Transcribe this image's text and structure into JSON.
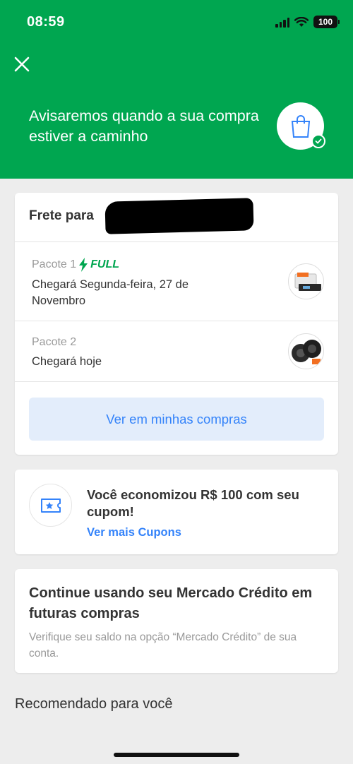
{
  "status_bar": {
    "time": "08:59",
    "battery": "100"
  },
  "header": {
    "message": "Avisaremos quando a sua compra estiver a caminho",
    "bg_color": "#00a650"
  },
  "shipping": {
    "title": "Frete para ",
    "packages": [
      {
        "label": "Pacote 1",
        "badge": "FULL",
        "delivery": "Chegará Segunda-feira, 27 de Novembro"
      },
      {
        "label": "Pacote 2",
        "delivery": "Chegará hoje"
      }
    ],
    "button_label": "Ver em minhas compras"
  },
  "coupon": {
    "message": "Você economizou R$ 100 com seu cupom!",
    "link_label": "Ver mais Cupons"
  },
  "credit": {
    "title": "Continue usando seu Mercado Crédito em futuras compras",
    "text": "Verifique seu saldo na opção “Mercado Crédito” de sua conta."
  },
  "recommendations": {
    "title": "Recomendado para você"
  },
  "colors": {
    "accent_blue": "#3483fa",
    "brand_green": "#00a650"
  },
  "icons": [
    "close-icon",
    "shopping-bag-icon",
    "check-icon",
    "lightning-icon",
    "coupon-icon",
    "signal-icon",
    "wifi-icon",
    "battery-icon"
  ]
}
